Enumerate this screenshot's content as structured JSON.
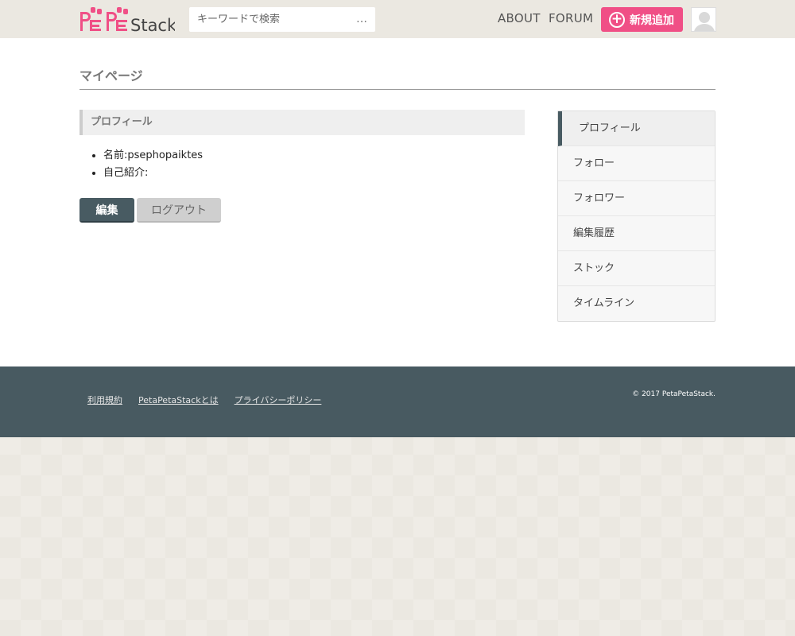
{
  "header": {
    "logo_text": "PetaPetaStack",
    "search_placeholder": "キーワードで検索",
    "search_more": "…",
    "nav": [
      {
        "label": "ABOUT"
      },
      {
        "label": "FORUM"
      }
    ],
    "add_button_label": "新規追加"
  },
  "main": {
    "page_title": "マイページ",
    "section_title": "プロフィール",
    "profile": {
      "name_item": "名前:psephopaiktes",
      "intro_item": "自己紹介:"
    },
    "buttons": {
      "edit": "編集",
      "logout": "ログアウト"
    },
    "side_menu": [
      {
        "label": "プロフィール",
        "active": true
      },
      {
        "label": "フォロー"
      },
      {
        "label": "フォロワー"
      },
      {
        "label": "編集履歴"
      },
      {
        "label": "ストック"
      },
      {
        "label": "タイムライン"
      }
    ]
  },
  "footer": {
    "links": [
      {
        "label": "利用規約"
      },
      {
        "label": "PetaPetaStackとは"
      },
      {
        "label": "プライバシーポリシー"
      }
    ],
    "copyright": "© 2017 PetaPetaStack."
  },
  "colors": {
    "brand_pink": "#f04f86",
    "dark_slate": "#485b62",
    "page_bg": "#ebe8e1"
  }
}
